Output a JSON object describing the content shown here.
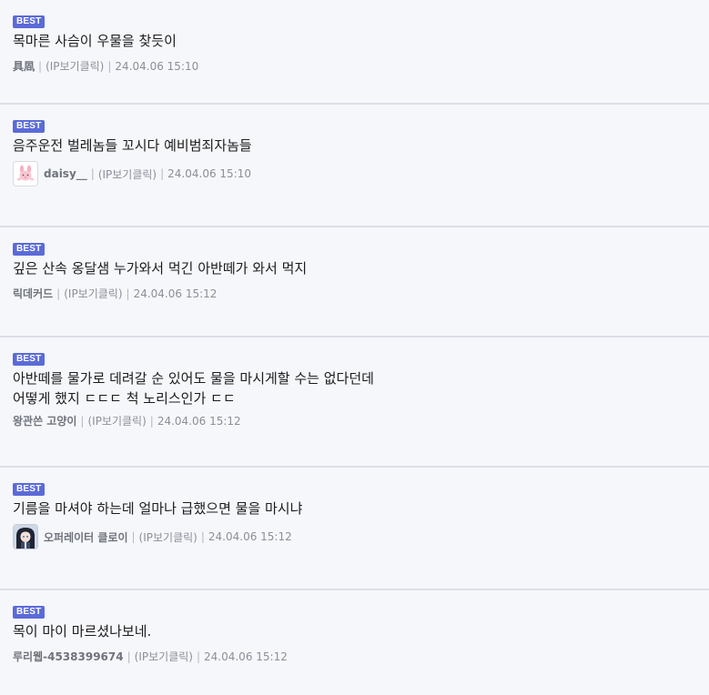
{
  "comments": [
    {
      "badge": "BEST",
      "lines": [
        "목마른 사슴이 우물을 찾듯이"
      ],
      "author": "具凮",
      "ip": "(IP보기클릭)",
      "date": "24.04.06 15:10",
      "avatar": null
    },
    {
      "badge": "BEST",
      "lines": [
        "음주운전 벌레놈들 꼬시다 예비범죄자놈들"
      ],
      "author": "daisy__",
      "ip": "(IP보기클릭)",
      "date": "24.04.06 15:10",
      "avatar": "pink-bunny-avatar"
    },
    {
      "badge": "BEST",
      "lines": [
        "깊은 산속 옹달샘 누가와서 먹긴 아반떼가 와서 먹지"
      ],
      "author": "릭데커드",
      "ip": "(IP보기클릭)",
      "date": "24.04.06 15:12",
      "avatar": null
    },
    {
      "badge": "BEST",
      "lines": [
        "아반떼를 물가로 데려갈 순 있어도 물을 마시게할 수는 없다던데",
        "어떻게 했지 ㄷㄷㄷ 척 노리스인가 ㄷㄷ"
      ],
      "author": "왕관쓴 고양이",
      "ip": "(IP보기클릭)",
      "date": "24.04.06 15:12",
      "avatar": null
    },
    {
      "badge": "BEST",
      "lines": [
        "기름을 마셔야 하는데 얼마나 급했으면 물을 마시냐"
      ],
      "author": "오퍼레이터 클로이",
      "ip": "(IP보기클릭)",
      "date": "24.04.06 15:12",
      "avatar": "anime-character-avatar"
    },
    {
      "badge": "BEST",
      "lines": [
        "목이 마이 마르셨나보네."
      ],
      "author": "루리웹-4538399674",
      "ip": "(IP보기클릭)",
      "date": "24.04.06 15:12",
      "avatar": null
    }
  ],
  "colors": {
    "background": "#f6f7fb",
    "badge": "#5b6bd8",
    "divider": "#dcdfe6",
    "meta_text": "#8b8f98"
  }
}
